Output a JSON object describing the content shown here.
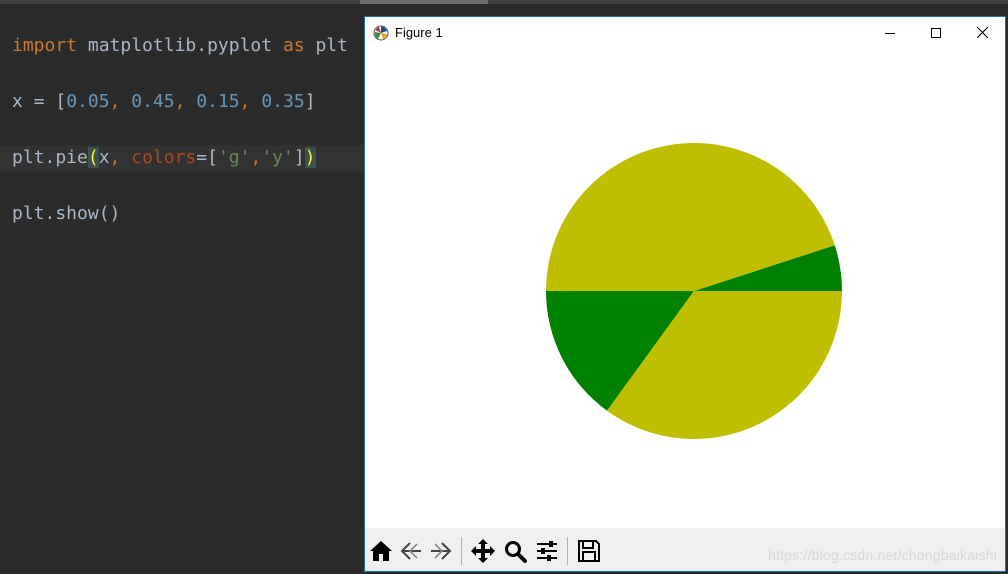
{
  "editor": {
    "lines": {
      "import_kw": "import",
      "import_module": " matplotlib.pyplot ",
      "as_kw": "as",
      "alias": " plt",
      "x_assign": "x = [",
      "v1": "0.05",
      "comma1": ", ",
      "v2": "0.45",
      "comma2": ", ",
      "v3": "0.15",
      "comma3": ", ",
      "v4": "0.35",
      "close_bracket": "]",
      "pie_call": "plt.pie",
      "open_paren": "(",
      "pie_args1": "x",
      "pie_comma": ", ",
      "colors_param": "colors",
      "eq_bracket": "=[",
      "str_g": "'g'",
      "str_comma": ",",
      "str_y": "'y'",
      "close_list": "]",
      "close_paren": ")",
      "show_call": "plt.show()"
    }
  },
  "window": {
    "title": "Figure 1",
    "icon": "matplotlib-logo-icon",
    "controls": [
      "minimize-icon",
      "maximize-icon",
      "close-icon"
    ]
  },
  "chart_data": {
    "type": "pie",
    "values": [
      0.05,
      0.45,
      0.15,
      0.35
    ],
    "colors": [
      "#008000",
      "#bfbf00",
      "#008000",
      "#bfbf00"
    ],
    "start_angle_deg": 0,
    "direction": "counterclockwise"
  },
  "toolbar": {
    "buttons": [
      "home-icon",
      "back-icon",
      "forward-icon",
      "pan-icon",
      "zoom-icon",
      "configure-subplots-icon",
      "save-icon"
    ]
  },
  "watermark": "https://blog.csdn.net/chongbaikaishi"
}
